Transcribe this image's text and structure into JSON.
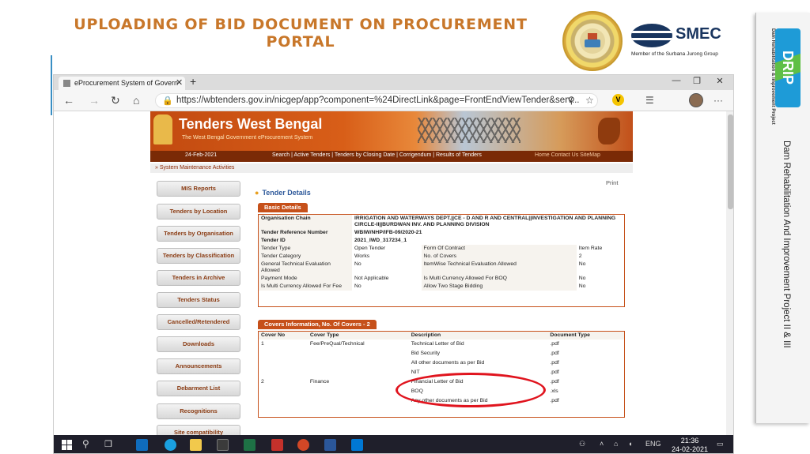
{
  "slide": {
    "title": "UPLOADING OF BID DOCUMENT ON PROCUREMENT PORTAL",
    "smec_name": "SMEC",
    "smec_tagline": "Member of the Surbana Jurong Group",
    "drip_small": "Dam Rehabilitation & Improvement Project",
    "drip_logo": "DRIP",
    "side_caption": "Dam Rehabilitation And Improvement Project II & III"
  },
  "browser": {
    "tab_title": "eProcurement System of Govern",
    "tab_close": "✕",
    "new_tab": "+",
    "win_minimize": "—",
    "win_restore": "❐",
    "win_close": "✕",
    "back": "←",
    "forward": "→",
    "reload": "↻",
    "home": "⌂",
    "lock": "🔒",
    "url": "https://wbtenders.gov.in/nicgep/app?component=%24DirectLink&page=FrontEndViewTender&serv...",
    "user_badge": "V",
    "zoom": "⚲",
    "favorite": "☆",
    "collections": "☰",
    "more": "···"
  },
  "site": {
    "banner_title": "Tenders West Bengal",
    "banner_sub": "The West Bengal Government eProcurement System",
    "date": "24-Feb-2021",
    "nav_links": "Search  |  Active Tenders  |  Tenders by Closing Date  |  Corrigendum  |  Results of Tenders",
    "nav_right": "Home   Contact Us   SiteMap",
    "alert": "» System Maintenance Activities",
    "print": "Print",
    "details_title": "Tender Details"
  },
  "sidebar": [
    "MIS Reports",
    "Tenders by Location",
    "Tenders by Organisation",
    "Tenders by Classification",
    "Tenders in Archive",
    "Tenders Status",
    "Cancelled/Retendered",
    "Downloads",
    "Announcements",
    "Debarment List",
    "Recognitions",
    "Site compatibility"
  ],
  "basic": {
    "tab": "Basic Details",
    "org_label": "Organisation Chain",
    "org_value": "IRRIGATION AND WATERWAYS DEPT.||CE - D AND R AND CENTRAL||INVESTIGATION AND PLANNING CIRCLE-II||BURDWAN INV. AND PLANNING DIVISION",
    "ref_label": "Tender Reference Number",
    "ref_value": "WBIW/NHP/IFB-09/2020-21",
    "id_label": "Tender ID",
    "id_value": "2021_IWD_317234_1",
    "rows": [
      [
        "Tender Type",
        "Open Tender",
        "Form Of Contract",
        "Item Rate"
      ],
      [
        "Tender Category",
        "Works",
        "No. of Covers",
        "2"
      ],
      [
        "General Technical Evaluation Allowed",
        "No",
        "ItemWise Technical Evaluation Allowed",
        "No"
      ],
      [
        "Payment Mode",
        "Not Applicable",
        "Is Multi Currency Allowed For BOQ",
        "No"
      ],
      [
        "Is Multi Currency Allowed For Fee",
        "No",
        "Allow Two Stage Bidding",
        "No"
      ]
    ]
  },
  "covers": {
    "tab": "Covers Information, No. Of Covers - 2",
    "headers": [
      "Cover No",
      "Cover Type",
      "Description",
      "Document Type"
    ],
    "rows": [
      [
        "1",
        "Fee/PreQual/Technical",
        "Technical Letter of Bid",
        ".pdf"
      ],
      [
        "",
        "",
        "Bid Security",
        ".pdf"
      ],
      [
        "",
        "",
        "All other documents as per Bid",
        ".pdf"
      ],
      [
        "",
        "",
        "NIT",
        ".pdf"
      ],
      [
        "2",
        "Finance",
        "Financial Letter of Bid",
        ".pdf"
      ],
      [
        "",
        "",
        "BOQ",
        ".xls"
      ],
      [
        "",
        "",
        "Any other documents as per Bid",
        ".pdf"
      ]
    ]
  },
  "taskbar": {
    "search": "⚲",
    "taskview": "❒",
    "tray_up": "˄",
    "net": "⌂",
    "volume": "◖",
    "lang": "ENG",
    "notify": "▭",
    "time": "21:36",
    "date": "24-02-2021"
  },
  "colors": {
    "title_orange": "#c8772a",
    "site_orange": "#c6501a",
    "highlight_red": "#e0141e",
    "link_blue": "#2f5a9b"
  }
}
